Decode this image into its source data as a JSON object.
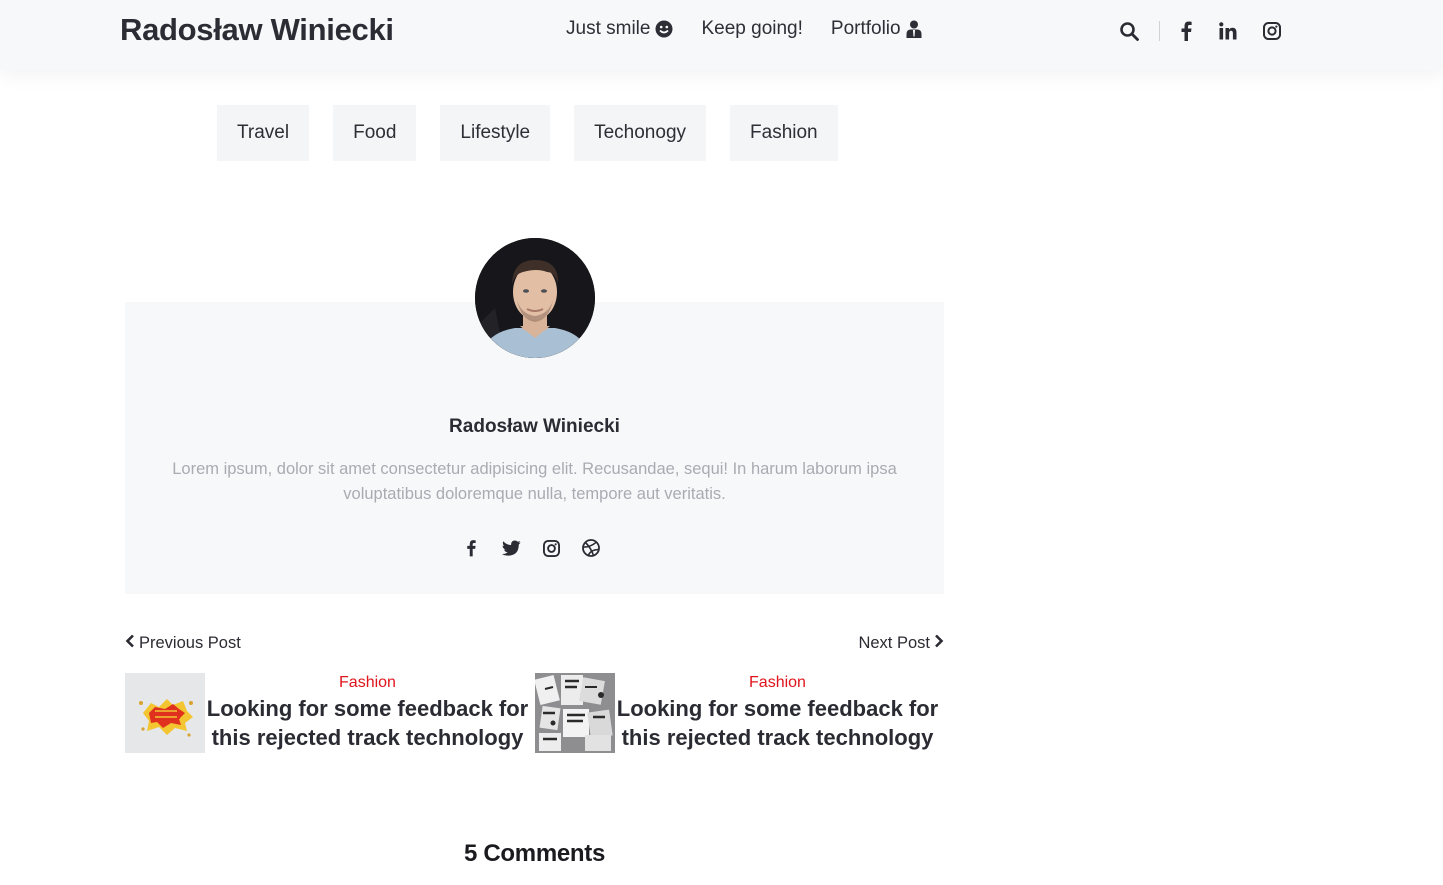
{
  "header": {
    "brand": "Radosław Winiecki",
    "nav": [
      {
        "label": "Just smile",
        "icon": "smile-icon"
      },
      {
        "label": "Keep going!"
      },
      {
        "label": "Portfolio",
        "icon": "user-tie-icon"
      }
    ],
    "icons": [
      "search-icon",
      "facebook-icon",
      "linkedin-icon",
      "instagram-icon"
    ]
  },
  "categories": [
    "Travel",
    "Food",
    "Lifestyle",
    "Techonogy",
    "Fashion"
  ],
  "author": {
    "name": "Radosław Winiecki",
    "bio": "Lorem ipsum, dolor sit amet consectetur adipisicing elit. Recusandae, sequi! In harum laborum ipsa voluptatibus doloremque nulla, tempore aut veritatis.",
    "social": [
      "facebook-icon",
      "twitter-icon",
      "instagram-icon",
      "dribbble-icon"
    ]
  },
  "post_nav": {
    "prev_label": "Previous Post",
    "next_label": "Next Post",
    "prev": {
      "category": "Fashion",
      "title": "Looking for some feedback for this rejected track technology"
    },
    "next": {
      "category": "Fashion",
      "title": "Looking for some feedback for this rejected track technology"
    }
  },
  "comments": {
    "heading": "5 Comments"
  },
  "colors": {
    "accent": "#e0141c",
    "card_bg": "#f7f8fa",
    "text": "#2b2b33",
    "muted": "#a9abb2"
  }
}
